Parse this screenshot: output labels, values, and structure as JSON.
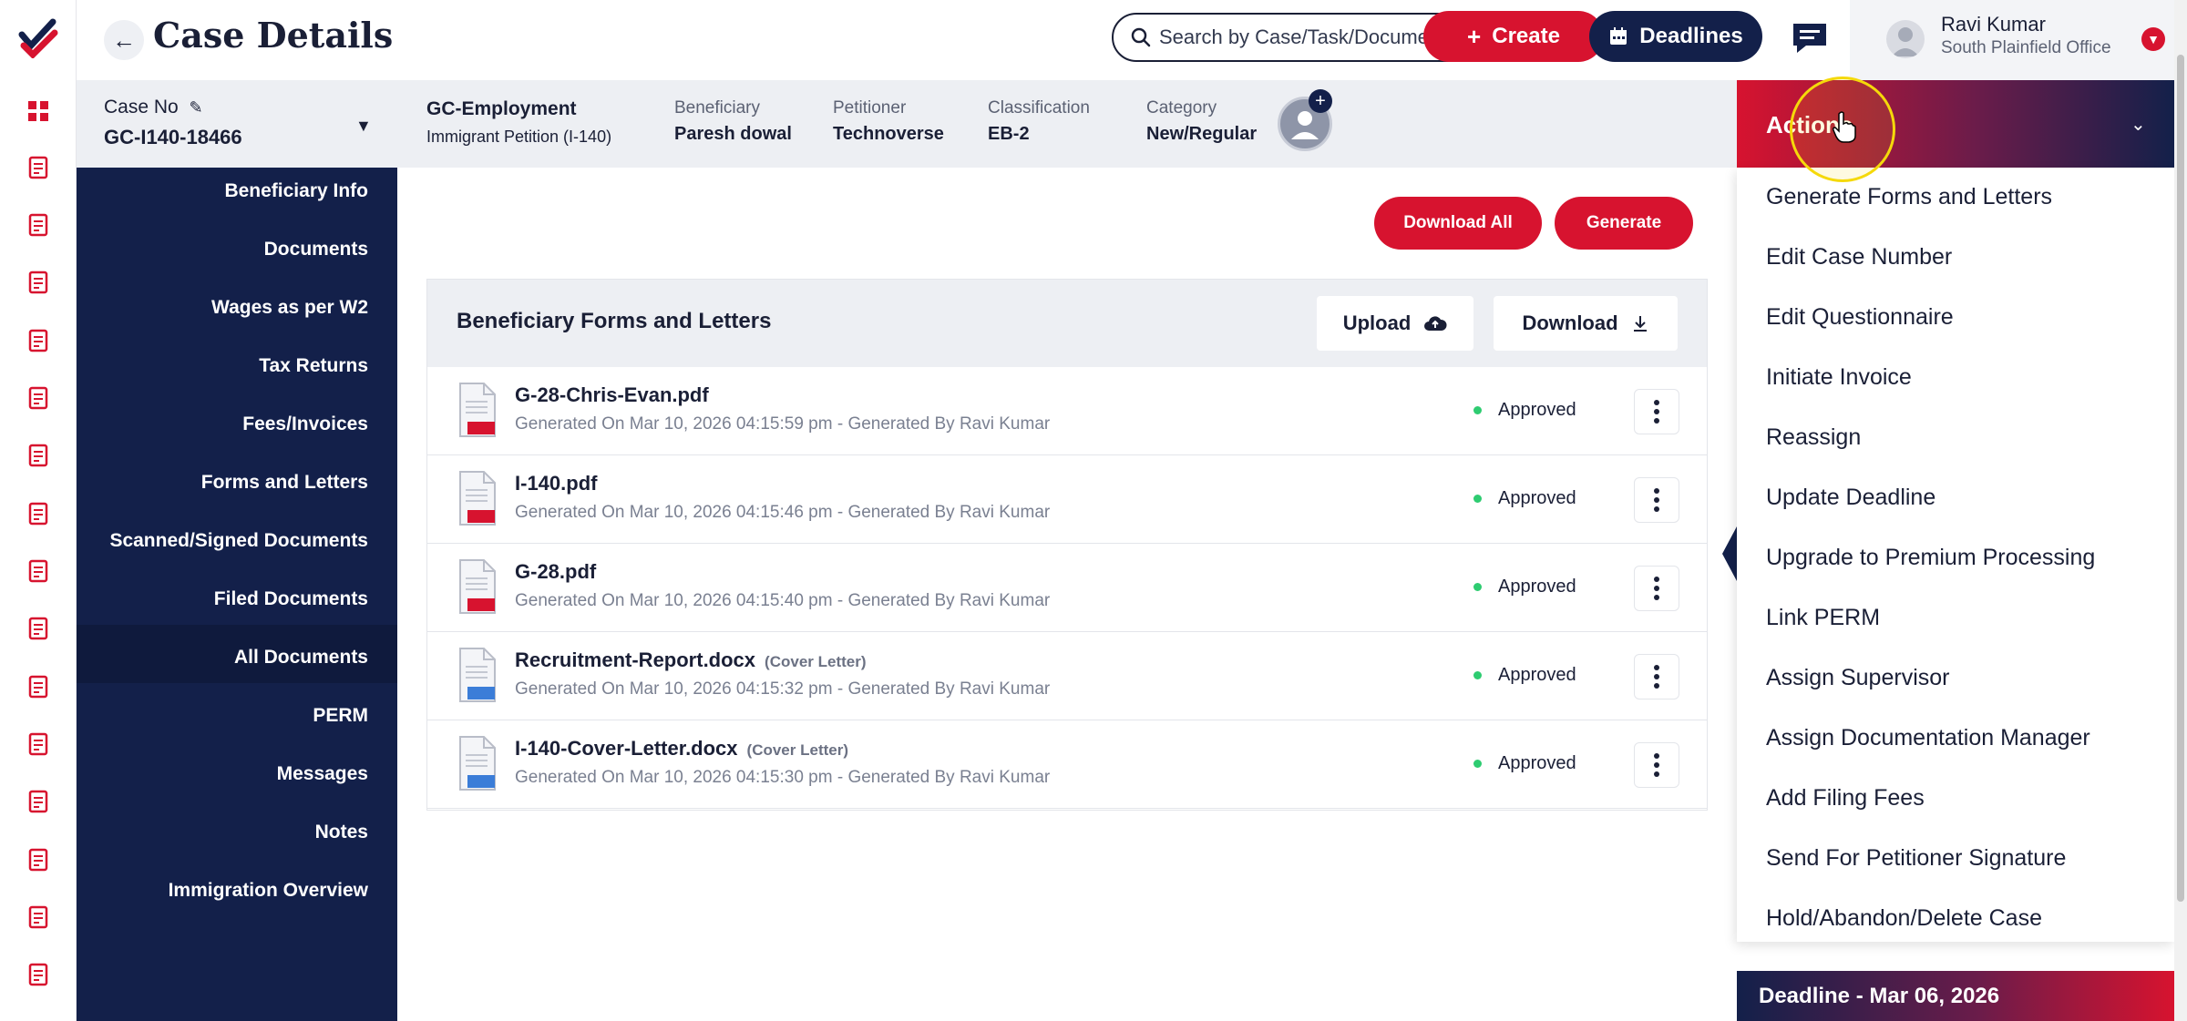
{
  "header": {
    "title": "Case Details",
    "search_placeholder": "Search by Case/Task/Document",
    "create_label": "Create",
    "deadlines_label": "Deadlines",
    "user_name": "Ravi Kumar",
    "user_office": "South Plainfield Office"
  },
  "case_info": {
    "case_no_label": "Case No",
    "case_no": "GC-I140-18466",
    "type_title": "GC-Employment",
    "type_sub": "Immigrant Petition (I-140)",
    "beneficiary_label": "Beneficiary",
    "beneficiary": "Paresh dowal",
    "petitioner_label": "Petitioner",
    "petitioner": "Technoverse",
    "classification_label": "Classification",
    "classification": "EB-2",
    "category_label": "Category",
    "category": "New/Regular"
  },
  "leftnav": {
    "items": [
      "Beneficiary Info",
      "Documents",
      "Wages as per W2",
      "Tax Returns",
      "Fees/Invoices",
      "Forms and Letters",
      "Scanned/Signed Documents",
      "Filed Documents",
      "All Documents",
      "PERM",
      "Messages",
      "Notes",
      "Immigration Overview"
    ],
    "active": "Forms and Letters"
  },
  "main": {
    "download_all_label": "Download All",
    "generate_label": "Generate",
    "panel_title": "Beneficiary Forms and Letters",
    "upload_label": "Upload",
    "download_label": "Download",
    "files": [
      {
        "name": "G-28-Chris-Evan.pdf",
        "tag": "",
        "type": "PDF",
        "meta": "Generated On Mar 10, 2026 04:15:59 pm - Generated By Ravi Kumar",
        "status": "Approved"
      },
      {
        "name": "I-140.pdf",
        "tag": "",
        "type": "PDF",
        "meta": "Generated On Mar 10, 2026 04:15:46 pm - Generated By Ravi Kumar",
        "status": "Approved"
      },
      {
        "name": "G-28.pdf",
        "tag": "",
        "type": "PDF",
        "meta": "Generated On Mar 10, 2026 04:15:40 pm - Generated By Ravi Kumar",
        "status": "Approved"
      },
      {
        "name": "Recruitment-Report.docx",
        "tag": "(Cover Letter)",
        "type": "DOC",
        "meta": "Generated On Mar 10, 2026 04:15:32 pm - Generated By Ravi Kumar",
        "status": "Approved"
      },
      {
        "name": "I-140-Cover-Letter.docx",
        "tag": "(Cover Letter)",
        "type": "DOC",
        "meta": "Generated On Mar 10, 2026 04:15:30 pm - Generated By Ravi Kumar",
        "status": "Approved"
      }
    ]
  },
  "actions": {
    "title": "Actions",
    "items": [
      "Generate Forms and Letters",
      "Edit Case Number",
      "Edit Questionnaire",
      "Initiate Invoice",
      "Reassign",
      "Update Deadline",
      "Upgrade to Premium Processing",
      "Link PERM",
      "Assign Supervisor",
      "Assign Documentation Manager",
      "Add Filing Fees",
      "Send For Petitioner Signature",
      "Hold/Abandon/Delete Case"
    ],
    "deadline": "Deadline - Mar 06, 2026"
  },
  "colors": {
    "brand_red": "#d7132f",
    "brand_navy": "#13204a",
    "approved_green": "#2ecc71"
  },
  "rail_icons": [
    "dashboard-icon",
    "cases-icon",
    "forms-icon",
    "calendar-icon",
    "docs-check-icon",
    "chat-icon",
    "ledger-icon",
    "edit-list-icon",
    "billing-icon",
    "clipboard-icon",
    "user-icon",
    "users-icon",
    "folder-icon",
    "notes-icon",
    "contact-icon",
    "report-icon"
  ]
}
